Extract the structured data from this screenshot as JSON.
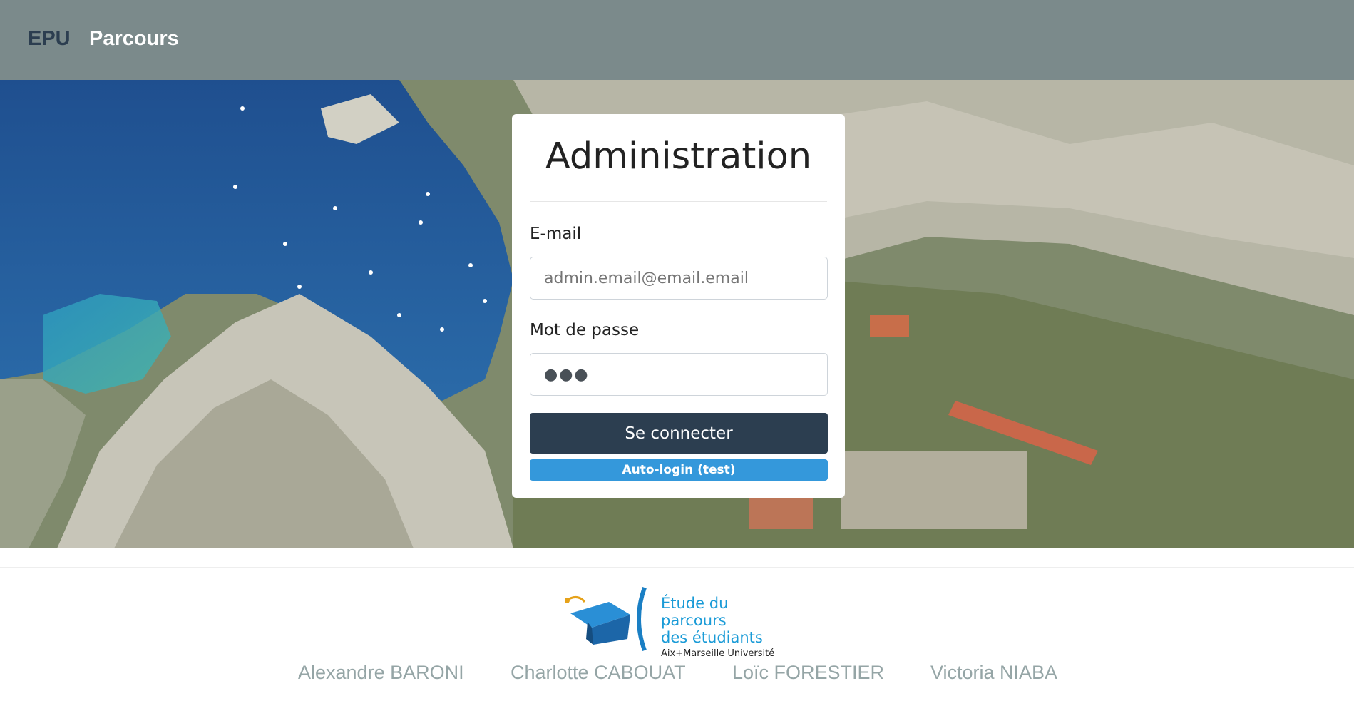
{
  "navbar": {
    "brand": "EPU",
    "link": "Parcours"
  },
  "hero": {
    "background": "coastal-landscape-photo"
  },
  "login": {
    "title": "Administration",
    "email_label": "E-mail",
    "email_placeholder": "admin.email@email.email",
    "password_label": "Mot de passe",
    "password_value": "●●●",
    "submit_label": "Se connecter",
    "autologin_label": "Auto-login (test)"
  },
  "footer": {
    "logo": {
      "line1": "Étude du parcours",
      "line2": "des étudiants",
      "line3": "Aix+Marseille Université"
    },
    "authors": [
      "Alexandre BARONI",
      "Charlotte CABOUAT",
      "Loïc FORESTIER",
      "Victoria NIABA"
    ]
  },
  "colors": {
    "navbar": "#7b8a8b",
    "primary": "#2c3e50",
    "info": "#3498db",
    "muted": "#95a5a6"
  }
}
